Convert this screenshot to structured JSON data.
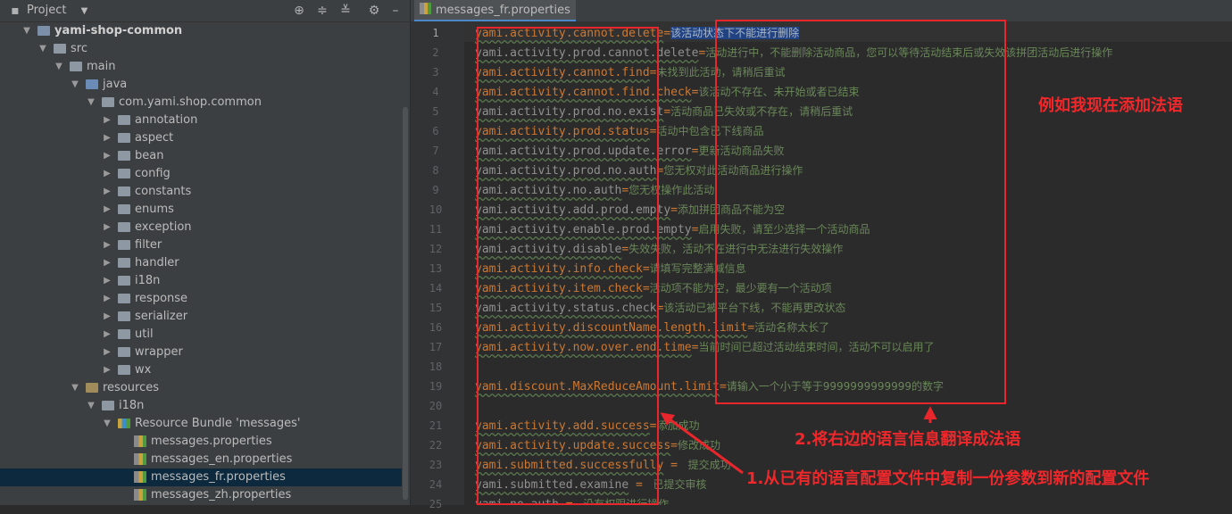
{
  "project_panel": {
    "title": "Project",
    "dropdown_icon": "chevron-down-icon",
    "toolbar_icons": [
      "locate-icon",
      "expand-all-icon",
      "collapse-all-icon",
      "settings-icon",
      "minimize-icon"
    ]
  },
  "tree": [
    {
      "label": "yami-shop-common",
      "level": 0,
      "expanded": true,
      "icon": "module",
      "bold": true
    },
    {
      "label": "src",
      "level": 1,
      "expanded": true,
      "icon": "folder"
    },
    {
      "label": "main",
      "level": 2,
      "expanded": true,
      "icon": "folder"
    },
    {
      "label": "java",
      "level": 3,
      "expanded": true,
      "icon": "src"
    },
    {
      "label": "com.yami.shop.common",
      "level": 4,
      "expanded": true,
      "icon": "package"
    },
    {
      "label": "annotation",
      "level": 5,
      "expanded": false,
      "icon": "package"
    },
    {
      "label": "aspect",
      "level": 5,
      "expanded": false,
      "icon": "package"
    },
    {
      "label": "bean",
      "level": 5,
      "expanded": false,
      "icon": "package"
    },
    {
      "label": "config",
      "level": 5,
      "expanded": false,
      "icon": "package"
    },
    {
      "label": "constants",
      "level": 5,
      "expanded": false,
      "icon": "package"
    },
    {
      "label": "enums",
      "level": 5,
      "expanded": false,
      "icon": "package"
    },
    {
      "label": "exception",
      "level": 5,
      "expanded": false,
      "icon": "package"
    },
    {
      "label": "filter",
      "level": 5,
      "expanded": false,
      "icon": "package"
    },
    {
      "label": "handler",
      "level": 5,
      "expanded": false,
      "icon": "package"
    },
    {
      "label": "i18n",
      "level": 5,
      "expanded": false,
      "icon": "package"
    },
    {
      "label": "response",
      "level": 5,
      "expanded": false,
      "icon": "package"
    },
    {
      "label": "serializer",
      "level": 5,
      "expanded": false,
      "icon": "package"
    },
    {
      "label": "util",
      "level": 5,
      "expanded": false,
      "icon": "package"
    },
    {
      "label": "wrapper",
      "level": 5,
      "expanded": false,
      "icon": "package"
    },
    {
      "label": "wx",
      "level": 5,
      "expanded": false,
      "icon": "package"
    },
    {
      "label": "resources",
      "level": 3,
      "expanded": true,
      "icon": "resources"
    },
    {
      "label": "i18n",
      "level": 4,
      "expanded": true,
      "icon": "folder"
    },
    {
      "label": "Resource Bundle 'messages'",
      "level": 5,
      "expanded": true,
      "icon": "bundle"
    },
    {
      "label": "messages.properties",
      "level": 6,
      "icon": "properties"
    },
    {
      "label": "messages_en.properties",
      "level": 6,
      "icon": "properties"
    },
    {
      "label": "messages_fr.properties",
      "level": 6,
      "icon": "properties",
      "selected": true
    },
    {
      "label": "messages_zh.properties",
      "level": 6,
      "icon": "properties"
    }
  ],
  "editor": {
    "tab_label": "messages_fr.properties",
    "current_line": 1,
    "lines": [
      {
        "n": "1",
        "key": "yami.activity.cannot.delete",
        "eq": "=",
        "val": "该活动状态下不能进行删除",
        "selected": true
      },
      {
        "n": "2",
        "key": "yami.activity.prod.cannot.delete",
        "eq": "=",
        "val": "活动进行中，不能删除活动商品，您可以等待活动结束后或失效该拼团活动后进行操作",
        "gray": true
      },
      {
        "n": "3",
        "key": "yami.activity.cannot.find",
        "eq": "=",
        "val": "未找到此活动，请稍后重试"
      },
      {
        "n": "4",
        "key": "yami.activity.cannot.find.check",
        "eq": "=",
        "val": "该活动不存在、未开始或者已结束"
      },
      {
        "n": "5",
        "key": "yami.activity.prod.no.exist",
        "eq": "=",
        "val": "活动商品已失效或不存在，请稍后重试",
        "gray": true
      },
      {
        "n": "6",
        "key": "yami.activity.prod.status",
        "eq": "=",
        "val": "活动中包含已下线商品"
      },
      {
        "n": "7",
        "key": "yami.activity.prod.update.error",
        "eq": "=",
        "val": "更新活动商品失败",
        "gray": true
      },
      {
        "n": "8",
        "key": "yami.activity.prod.no.auth",
        "eq": "=",
        "val": "您无权对此活动商品进行操作",
        "gray": true
      },
      {
        "n": "9",
        "key": "yami.activity.no.auth",
        "eq": "=",
        "val": "您无权操作此活动",
        "gray": true
      },
      {
        "n": "10",
        "key": "yami.activity.add.prod.empty",
        "eq": "=",
        "val": "添加拼团商品不能为空",
        "gray": true
      },
      {
        "n": "11",
        "key": "yami.activity.enable.prod.empty",
        "eq": "=",
        "val": "启用失败，请至少选择一个活动商品",
        "gray": true
      },
      {
        "n": "12",
        "key": "yami.activity.disable",
        "eq": "=",
        "val": "失效失败，活动不在进行中无法进行失效操作",
        "gray": true
      },
      {
        "n": "13",
        "key": "yami.activity.info.check",
        "eq": "=",
        "val": "请填写完整满减信息"
      },
      {
        "n": "14",
        "key": "yami.activity.item.check",
        "eq": "=",
        "val": "活动项不能为空，最少要有一个活动项"
      },
      {
        "n": "15",
        "key": "yami.activity.status.check",
        "eq": "=",
        "val": "该活动已被平台下线，不能再更改状态",
        "gray": true
      },
      {
        "n": "16",
        "key": "yami.activity.discountName.length.limit",
        "eq": "=",
        "val": "活动名称太长了"
      },
      {
        "n": "17",
        "key": "yami.activity.now.over.end.time",
        "eq": "=",
        "val": "当前时间已超过活动结束时间，活动不可以启用了"
      },
      {
        "n": "18",
        "key": "",
        "eq": "",
        "val": ""
      },
      {
        "n": "19",
        "key": "yami.discount.MaxReduceAmount.limit",
        "eq": "=",
        "val": "请输入一个小于等于9999999999999的数字"
      },
      {
        "n": "20",
        "key": "",
        "eq": "",
        "val": ""
      },
      {
        "n": "21",
        "key": "yami.activity.add.success",
        "eq": "=",
        "val": "添加成功"
      },
      {
        "n": "22",
        "key": "yami.activity.update.success",
        "eq": "=",
        "val": "修改成功"
      },
      {
        "n": "23",
        "key": "yami.submitted.successfully",
        "eq": " = ",
        "val": " 提交成功"
      },
      {
        "n": "24",
        "key": "yami.submitted.examine",
        "eq": " = ",
        "val": " 已提交审核",
        "gray": true
      },
      {
        "n": "25",
        "key": "yami.no.auth",
        "eq": " = ",
        "val": " 没有权限进行操作",
        "gray": true
      }
    ]
  },
  "annotations": {
    "note_top": "例如我现在添加法语",
    "note_step2": "2.将右边的语言信息翻译成法语",
    "note_step1": "1.从已有的语言配置文件中复制一份参数到新的配置文件"
  },
  "colors": {
    "annotation_red": "#e8262b",
    "key_orange": "#cc7832",
    "value_green": "#6a8759",
    "selection_blue": "#214283"
  }
}
